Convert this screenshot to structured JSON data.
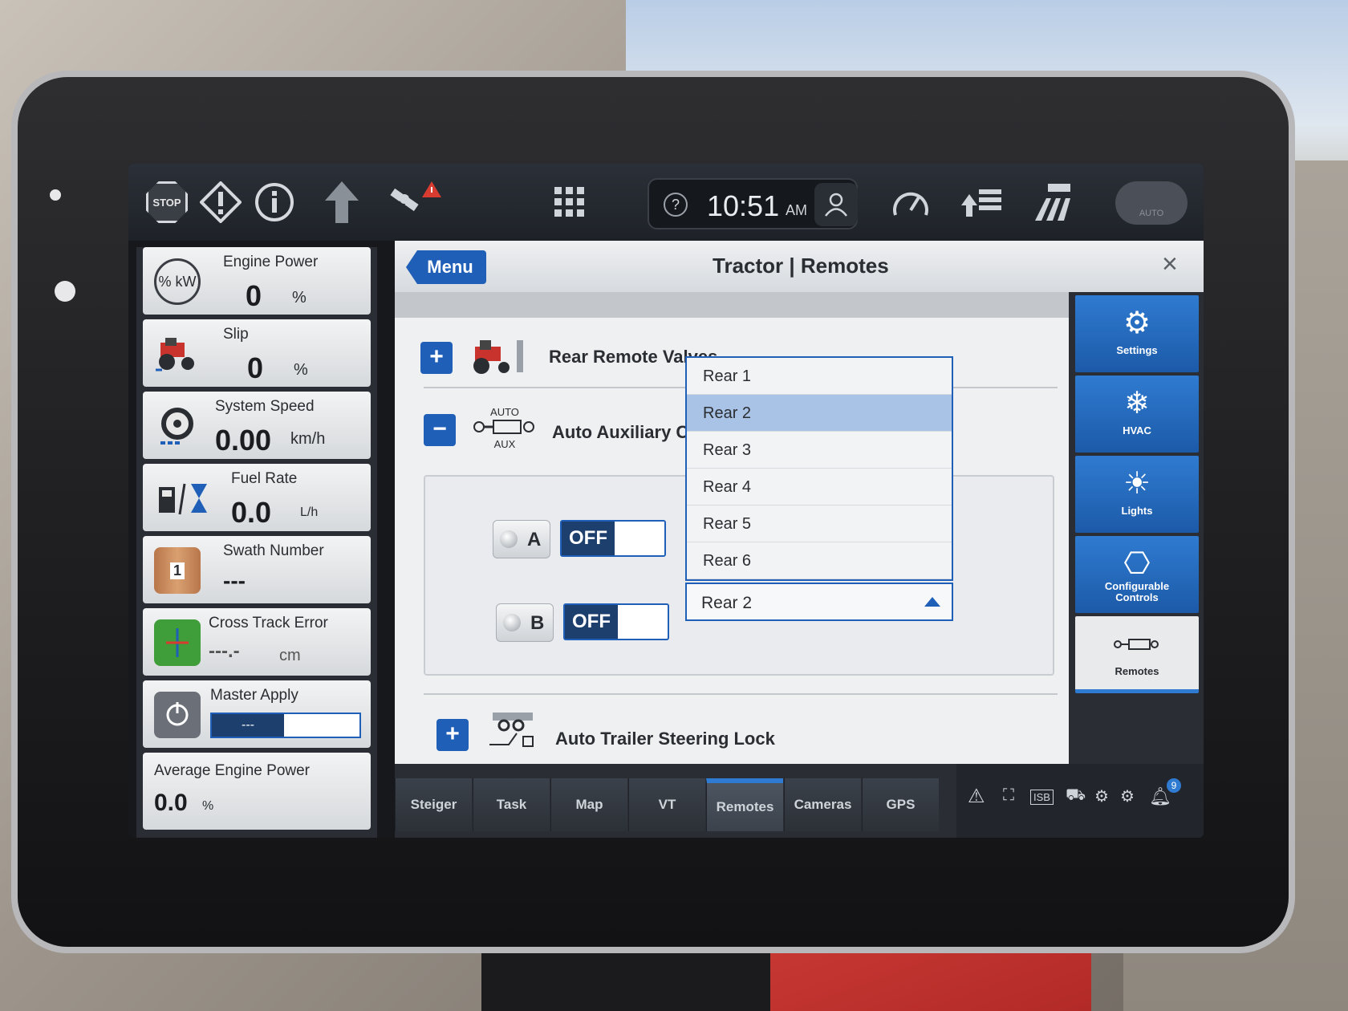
{
  "topbar": {
    "stop_label": "STOP",
    "time": "10:51",
    "ampm": "AM",
    "help_glyph": "?",
    "auto_label": "AUTO",
    "icons": [
      "stop-icon",
      "warning-icon",
      "info-icon",
      "upload-arrow-icon",
      "gps-satellite-warning-icon",
      "apps-grid-icon",
      "help-icon",
      "user-icon",
      "performance-gauge-icon",
      "headland-icon",
      "field-implement-icon",
      "auto-steer-button"
    ]
  },
  "widgets": [
    {
      "title": "Engine Power",
      "value": "0",
      "unit": "%",
      "icon": "% kW"
    },
    {
      "title": "Slip",
      "value": "0",
      "unit": "%",
      "icon": "tractor-icon"
    },
    {
      "title": "System Speed",
      "value": "0.00",
      "unit": "km/h",
      "icon": "speed-icon"
    },
    {
      "title": "Fuel Rate",
      "value": "0.0",
      "unit": "L/h",
      "icon": "fuel-icon"
    },
    {
      "title": "Swath Number",
      "value": "---",
      "unit": "",
      "icon": "1"
    },
    {
      "title": "Cross Track Error",
      "value": "---.-",
      "unit": "cm",
      "icon": "cross-track-icon"
    },
    {
      "title": "Master Apply",
      "value": "---",
      "unit": "",
      "icon": "master-apply-icon"
    },
    {
      "title": "Average Engine Power",
      "value": "0.0",
      "unit": "%",
      "icon": ""
    }
  ],
  "header": {
    "menu_label": "Menu",
    "title": "Tractor | Remotes",
    "close_glyph": "×"
  },
  "content": {
    "rear_remote_label": "Rear Remote Valves",
    "auto_aux_label": "Auto Auxiliary Contr",
    "auto_aux_icon_top": "AUTO",
    "auto_aux_icon_bottom": "AUX",
    "trailer_label": "Auto Trailer Steering Lock",
    "plus": "+",
    "minus": "−",
    "channel_a": {
      "label": "A",
      "value": "OFF"
    },
    "channel_b": {
      "label": "B",
      "value": "OFF"
    },
    "dropdown": {
      "options": [
        "Rear 1",
        "Rear 2",
        "Rear 3",
        "Rear 4",
        "Rear 5",
        "Rear 6"
      ],
      "selected": "Rear 2"
    }
  },
  "sidenav": [
    {
      "label": "Settings"
    },
    {
      "label": "HVAC"
    },
    {
      "label": "Lights"
    },
    {
      "label": "Configurable Controls"
    },
    {
      "label": "Remotes"
    }
  ],
  "tabs": [
    "Steiger",
    "Task",
    "Map",
    "VT",
    "Remotes",
    "Cameras",
    "GPS"
  ],
  "status": {
    "isb_label": "ISB",
    "notification_count": "9"
  },
  "colors": {
    "accent": "#1f5fb8",
    "header_bg": "#eef0f2",
    "dark_bg": "#2a2e34"
  }
}
